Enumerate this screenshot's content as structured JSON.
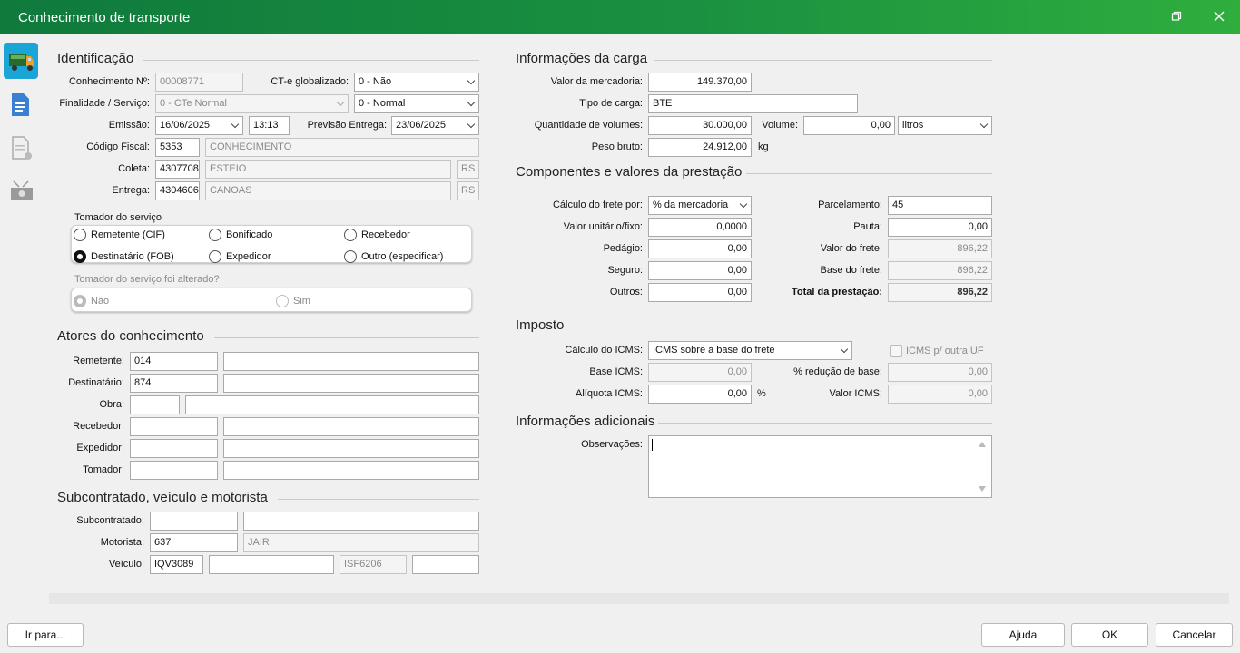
{
  "window": {
    "title": "Conhecimento de transporte",
    "restore_icon": "restore-icon",
    "close_icon": "close-icon"
  },
  "sidebar": {
    "items": [
      "truck-icon",
      "document-icon",
      "document-settings-icon",
      "money-icon"
    ]
  },
  "identificacao": {
    "title": "Identificação",
    "conhecimento_label": "Conhecimento Nº:",
    "conhecimento_value": "00008771",
    "cte_label": "CT-e globalizado:",
    "cte_value": "0 - Não",
    "finalidade_label": "Finalidade / Serviço:",
    "finalidade_value": "0 - CTe Normal",
    "servico_value": "0 - Normal",
    "emissao_label": "Emissão:",
    "emissao_date": "16/06/2025",
    "emissao_time": "13:13",
    "previsao_label": "Previsão Entrega:",
    "previsao_value": "23/06/2025",
    "codigo_label": "Código Fiscal:",
    "codigo_value": "5353",
    "codigo_desc": "CONHECIMENTO",
    "coleta_label": "Coleta:",
    "coleta_code": "4307708",
    "coleta_city": "ESTEIO",
    "coleta_uf": "RS",
    "entrega_label": "Entrega:",
    "entrega_code": "4304606",
    "entrega_city": "CANOAS",
    "entrega_uf": "RS"
  },
  "tomador": {
    "title": "Tomador do serviço",
    "options": [
      "Remetente (CIF)",
      "Bonificado",
      "Recebedor",
      "Destinatário (FOB)",
      "Expedidor",
      "Outro (especificar)"
    ],
    "selected": "Destinatário (FOB)",
    "alterado_title": "Tomador do serviço foi alterado?",
    "alterado_options": [
      "Não",
      "Sim"
    ]
  },
  "atores": {
    "title": "Atores do conhecimento",
    "remetente_label": "Remetente:",
    "remetente_code": "014",
    "destinatario_label": "Destinatário:",
    "destinatario_code": "874",
    "obra_label": "Obra:",
    "recebedor_label": "Recebedor:",
    "expedidor_label": "Expedidor:",
    "tomador_label": "Tomador:"
  },
  "subcontratado": {
    "title": "Subcontratado, veículo e motorista",
    "subcontratado_label": "Subcontratado:",
    "motorista_label": "Motorista:",
    "motorista_code": "637",
    "motorista_name": "JAIR",
    "veiculo_label": "Veículo:",
    "veiculo_placa": "IQV3089",
    "veiculo_placa2": "ISF6206"
  },
  "carga": {
    "title": "Informações da carga",
    "valor_label": "Valor da mercadoria:",
    "valor_value": "149.370,00",
    "tipo_label": "Tipo de carga:",
    "tipo_value": "BTE",
    "qtd_label": "Quantidade de volumes:",
    "qtd_value": "30.000,00",
    "volume_label": "Volume:",
    "volume_value": "0,00",
    "volume_unit": "litros",
    "peso_label": "Peso bruto:",
    "peso_value": "24.912,00",
    "peso_unit": "kg"
  },
  "componentes": {
    "title": "Componentes e valores da prestação",
    "calculo_label": "Cálculo do frete por:",
    "calculo_value": "% da mercadoria",
    "valor_unit_label": "Valor unitário/fixo:",
    "valor_unit_value": "0,0000",
    "pedagio_label": "Pedágio:",
    "pedagio_value": "0,00",
    "seguro_label": "Seguro:",
    "seguro_value": "0,00",
    "outros_label": "Outros:",
    "outros_value": "0,00",
    "parcelamento_label": "Parcelamento:",
    "parcelamento_value": "45",
    "pauta_label": "Pauta:",
    "pauta_value": "0,00",
    "valor_frete_label": "Valor do frete:",
    "valor_frete_value": "896,22",
    "base_frete_label": "Base do frete:",
    "base_frete_value": "896,22",
    "total_label": "Total da prestação:",
    "total_value": "896,22"
  },
  "imposto": {
    "title": "Imposto",
    "calculo_label": "Cálculo do ICMS:",
    "calculo_value": "ICMS sobre a base do frete",
    "icms_uf_label": "ICMS p/ outra UF",
    "base_label": "Base ICMS:",
    "base_value": "0,00",
    "reducao_label": "% redução de base:",
    "reducao_value": "0,00",
    "aliquota_label": "Alíquota ICMS:",
    "aliquota_value": "0,00",
    "aliquota_unit": "%",
    "valor_label": "Valor ICMS:",
    "valor_value": "0,00"
  },
  "adicionais": {
    "title": "Informações adicionais",
    "obs_label": "Observações:"
  },
  "footer": {
    "ir_para": "Ir para...",
    "ajuda": "Ajuda",
    "ok": "OK",
    "cancelar": "Cancelar"
  }
}
